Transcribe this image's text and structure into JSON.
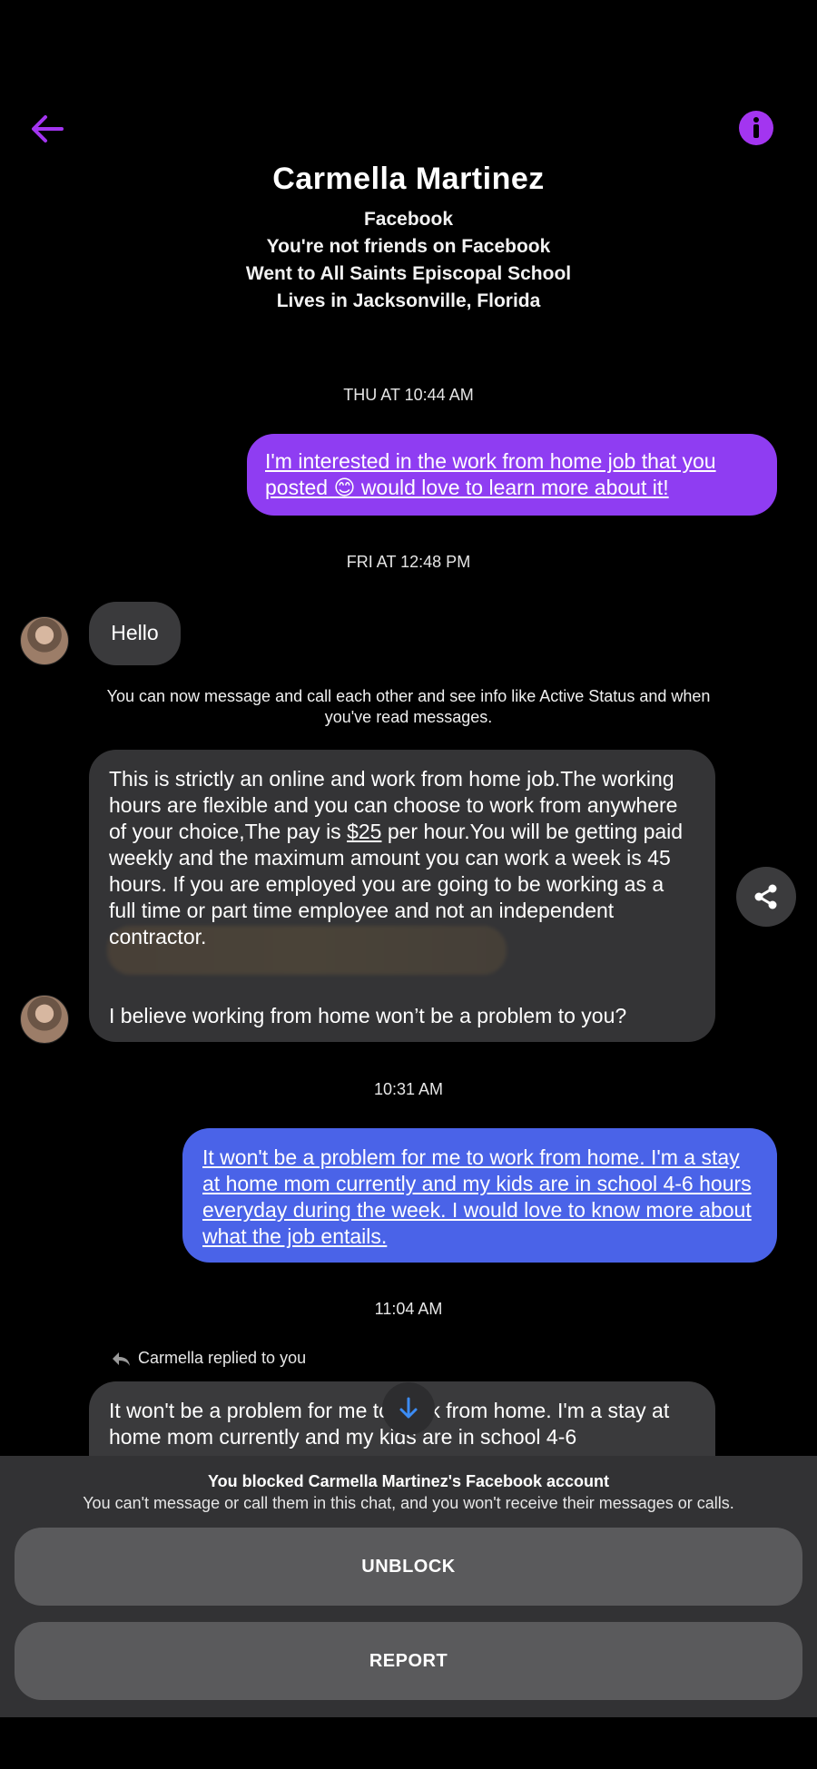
{
  "colors": {
    "accent": "#a335f0",
    "outgoing_bubble_1": "#8f3df2",
    "outgoing_bubble_2": "#4a63e8",
    "incoming_bubble": "#3a3a3c",
    "panel": "#323234",
    "button": "#5a5a5c"
  },
  "header": {
    "back_icon": "arrow-left-icon",
    "info_icon": "info-icon"
  },
  "profile": {
    "name": "Carmella Martinez",
    "platform": "Facebook",
    "friend_status": "You're not friends on Facebook",
    "education": "Went to All Saints Episcopal School",
    "location": "Lives in Jacksonville, Florida"
  },
  "conversation": {
    "ts1": "THU AT 10:44 AM",
    "msg1": "I'm interested in the work from home job that you posted 😊 would love to learn more about it!",
    "ts2": "FRI AT 12:48 PM",
    "msg2": "Hello",
    "system_note": "You can now message and call each other and see info like Active Status and when you've read messages.",
    "msg3_part1": "This is strictly an online and work from home job.The working hours are flexible and you can choose to work from anywhere of your choice,The pay is ",
    "msg3_pay": "$25",
    "msg3_part2": " per hour.You will be getting paid weekly and the maximum amount you can work a week is 45 hours. If you are employed you are going to be working as a full time or part time employee and not an independent contractor.",
    "msg3_part3": "I believe working from home won’t be a problem to you?",
    "ts3": "10:31 AM",
    "msg4": "It won't be a problem for me to work from home. I'm a stay at home mom currently and my kids are in school 4-6 hours everyday during the week. I would love to know more about what the job entails.",
    "ts4": "11:04 AM",
    "reply_label": "Carmella replied to you",
    "msg5_quote": "It won't be a problem for me to work from home. I'm a stay at home mom currently and my kids are in school 4-6"
  },
  "block": {
    "title": "You blocked Carmella Martinez's Facebook account",
    "subtitle": "You can't message or call them in this chat, and you won't receive their messages or calls.",
    "unblock_label": "UNBLOCK",
    "report_label": "REPORT"
  }
}
